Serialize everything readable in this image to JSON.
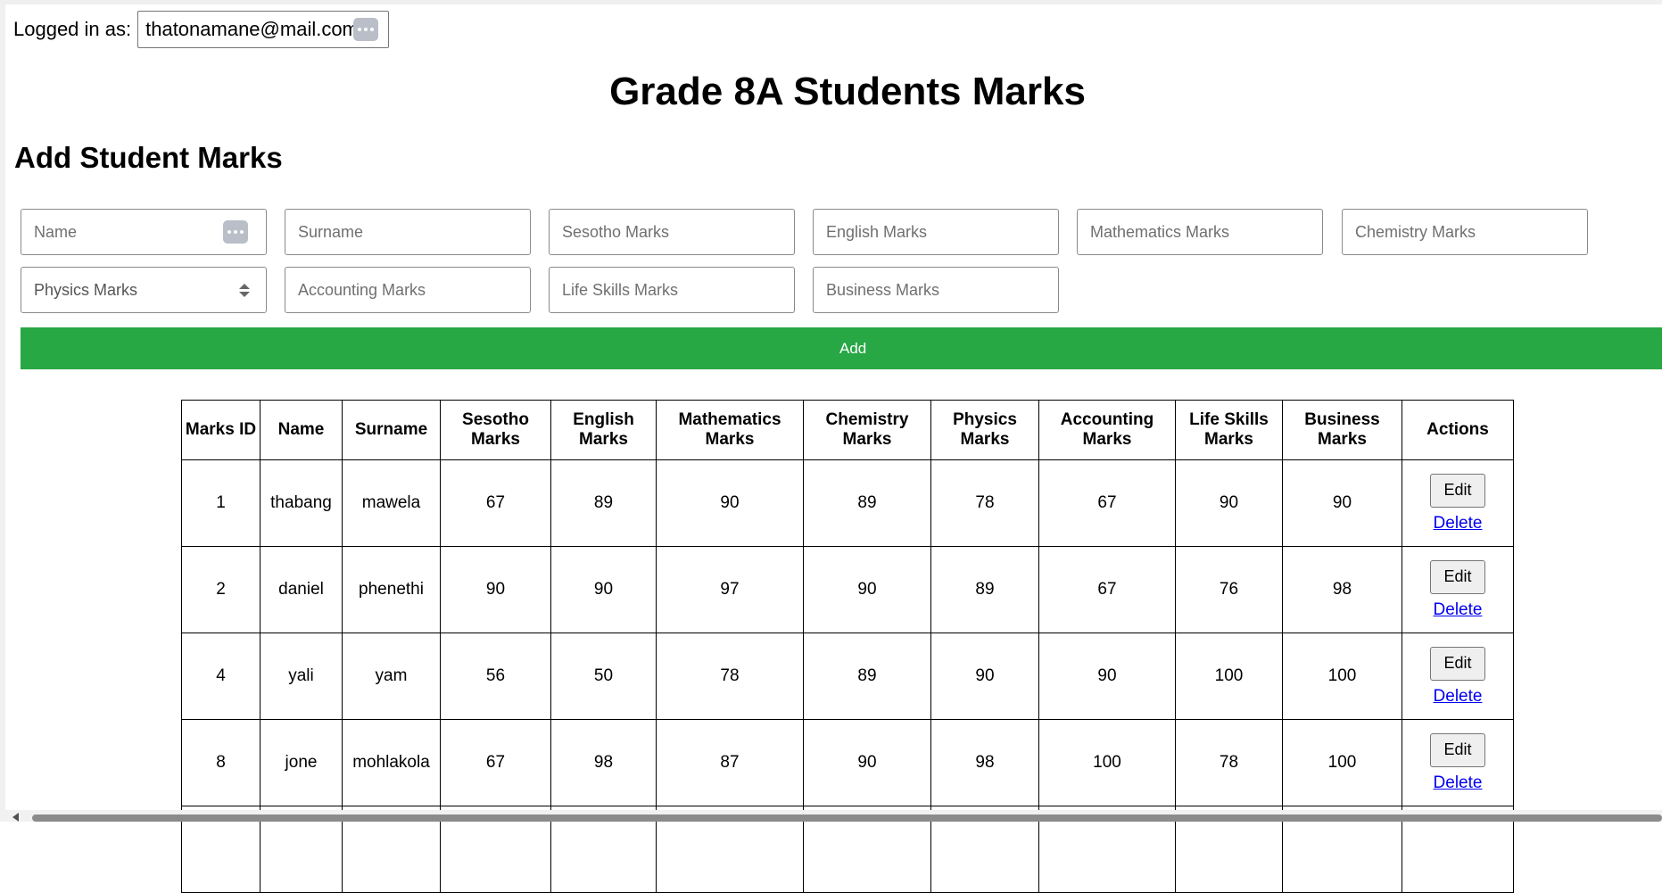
{
  "login": {
    "label": "Logged in as:",
    "email": "thatonamane@mail.com"
  },
  "page_title": "Grade 8A Students Marks",
  "form": {
    "title": "Add Student Marks",
    "placeholders": {
      "name": "Name",
      "surname": "Surname",
      "sesotho": "Sesotho Marks",
      "english": "English Marks",
      "mathematics": "Mathematics Marks",
      "chemistry": "Chemistry Marks",
      "physics": "Physics Marks",
      "accounting": "Accounting Marks",
      "life_skills": "Life Skills Marks",
      "business": "Business Marks"
    },
    "add_label": "Add",
    "add_color": "#28a745"
  },
  "table": {
    "headers": [
      "Marks ID",
      "Name",
      "Surname",
      "Sesotho Marks",
      "English Marks",
      "Mathematics Marks",
      "Chemistry Marks",
      "Physics Marks",
      "Accounting Marks",
      "Life Skills Marks",
      "Business Marks",
      "Actions"
    ],
    "rows": [
      [
        "1",
        "thabang",
        "mawela",
        "67",
        "89",
        "90",
        "89",
        "78",
        "67",
        "90",
        "90"
      ],
      [
        "2",
        "daniel",
        "phenethi",
        "90",
        "90",
        "97",
        "90",
        "89",
        "67",
        "76",
        "98"
      ],
      [
        "4",
        "yali",
        "yam",
        "56",
        "50",
        "78",
        "89",
        "90",
        "90",
        "100",
        "100"
      ],
      [
        "8",
        "jone",
        "mohlakola",
        "67",
        "98",
        "87",
        "90",
        "98",
        "100",
        "78",
        "100"
      ]
    ],
    "edit_label": "Edit",
    "delete_label": "Delete"
  },
  "icons": {
    "password_manager": "password-manager-icon",
    "select_arrows": "updown-arrows-icon",
    "scroll_left": "scroll-left-arrow-icon"
  }
}
